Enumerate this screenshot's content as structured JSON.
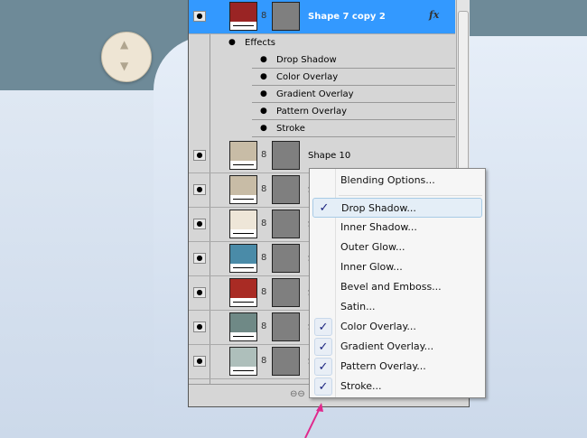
{
  "selected_layer": {
    "name": "Shape 7 copy 2",
    "swatch": "#9a2424",
    "fx": "fx"
  },
  "effects_label": "Effects",
  "effects": [
    "Drop Shadow",
    "Color Overlay",
    "Gradient Overlay",
    "Pattern Overlay",
    "Stroke"
  ],
  "layers": [
    {
      "name": "Shape 10",
      "swatch": "#c8bca6"
    },
    {
      "name": "S",
      "swatch": "#c8bca6"
    },
    {
      "name": "S",
      "swatch": "#eee6d8"
    },
    {
      "name": "S",
      "swatch": "#4a8ba8"
    },
    {
      "name": "S",
      "swatch": "#a92b24"
    },
    {
      "name": "S",
      "swatch": "#6f8986"
    },
    {
      "name": "S",
      "swatch": "#aebfbb"
    }
  ],
  "menu": {
    "header": "Blending Options...",
    "items": [
      {
        "label": "Drop Shadow...",
        "checked": true
      },
      {
        "label": "Inner Shadow...",
        "checked": false
      },
      {
        "label": "Outer Glow...",
        "checked": false
      },
      {
        "label": "Inner Glow...",
        "checked": false
      },
      {
        "label": "Bevel and Emboss...",
        "checked": false
      },
      {
        "label": "Satin...",
        "checked": false
      },
      {
        "label": "Color Overlay...",
        "checked": true
      },
      {
        "label": "Gradient Overlay...",
        "checked": true
      },
      {
        "label": "Pattern Overlay...",
        "checked": true
      },
      {
        "label": "Stroke...",
        "checked": true
      }
    ],
    "check_glyph": "✓"
  },
  "arrow_color": "#e0288c"
}
